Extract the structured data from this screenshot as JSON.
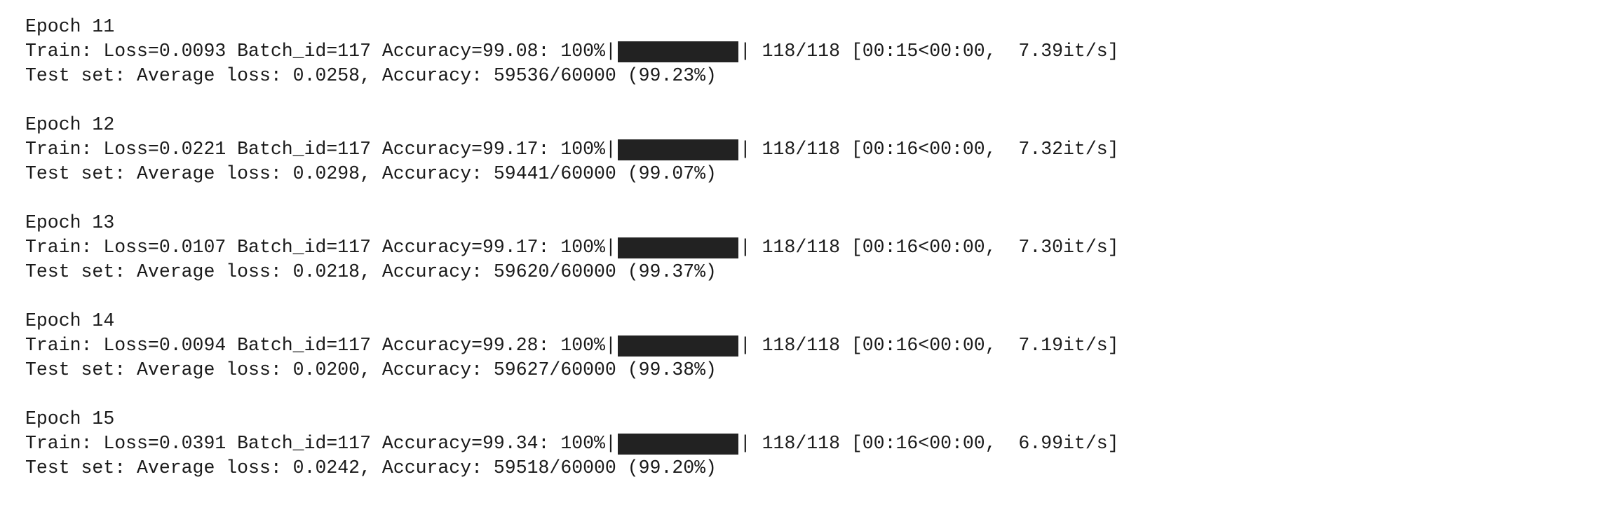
{
  "theme": {
    "background": "#ffffff",
    "text_color": "#1a1a1a",
    "progress_fill_color": "#222222"
  },
  "epochs": [
    {
      "header": "Epoch 11",
      "train_prefix": "Train: Loss=0.0093 Batch_id=117 Accuracy=99.08: 100%",
      "progress_fraction": 1.0,
      "train_suffix": " 118/118 [00:15<00:00,  7.39it/s]",
      "test_line": "Test set: Average loss: 0.0258, Accuracy: 59536/60000 (99.23%)"
    },
    {
      "header": "Epoch 12",
      "train_prefix": "Train: Loss=0.0221 Batch_id=117 Accuracy=99.17: 100%",
      "progress_fraction": 1.0,
      "train_suffix": " 118/118 [00:16<00:00,  7.32it/s]",
      "test_line": "Test set: Average loss: 0.0298, Accuracy: 59441/60000 (99.07%)"
    },
    {
      "header": "Epoch 13",
      "train_prefix": "Train: Loss=0.0107 Batch_id=117 Accuracy=99.17: 100%",
      "progress_fraction": 1.0,
      "train_suffix": " 118/118 [00:16<00:00,  7.30it/s]",
      "test_line": "Test set: Average loss: 0.0218, Accuracy: 59620/60000 (99.37%)"
    },
    {
      "header": "Epoch 14",
      "train_prefix": "Train: Loss=0.0094 Batch_id=117 Accuracy=99.28: 100%",
      "progress_fraction": 1.0,
      "train_suffix": " 118/118 [00:16<00:00,  7.19it/s]",
      "test_line": "Test set: Average loss: 0.0200, Accuracy: 59627/60000 (99.38%)"
    },
    {
      "header": "Epoch 15",
      "train_prefix": "Train: Loss=0.0391 Batch_id=117 Accuracy=99.34: 100%",
      "progress_fraction": 1.0,
      "train_suffix": " 118/118 [00:16<00:00,  6.99it/s]",
      "test_line": "Test set: Average loss: 0.0242, Accuracy: 59518/60000 (99.20%)"
    }
  ]
}
